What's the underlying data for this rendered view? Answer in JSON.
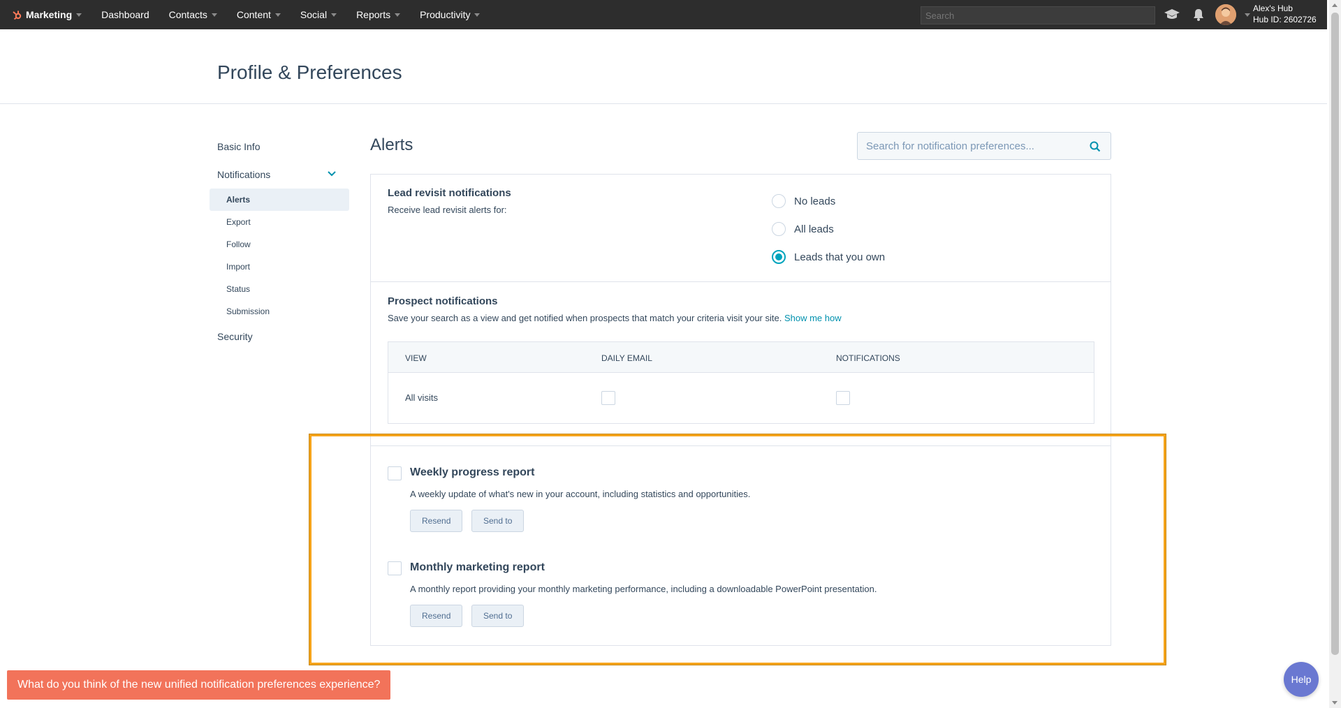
{
  "topnav": {
    "brand": "Marketing",
    "items": [
      {
        "label": "Dashboard",
        "dropdown": false
      },
      {
        "label": "Contacts",
        "dropdown": true
      },
      {
        "label": "Content",
        "dropdown": true
      },
      {
        "label": "Social",
        "dropdown": true
      },
      {
        "label": "Reports",
        "dropdown": true
      },
      {
        "label": "Productivity",
        "dropdown": true
      }
    ],
    "search_placeholder": "Search",
    "hub_name": "Alex's Hub",
    "hub_id": "Hub ID: 2602726"
  },
  "page": {
    "title": "Profile & Preferences"
  },
  "sidebar": {
    "basic_info": "Basic Info",
    "notifications": "Notifications",
    "sub_items": [
      "Alerts",
      "Export",
      "Follow",
      "Import",
      "Status",
      "Submission"
    ],
    "active": "Alerts",
    "security": "Security"
  },
  "main": {
    "title": "Alerts",
    "search_placeholder": "Search for notification preferences..."
  },
  "lead_revisit": {
    "title": "Lead revisit notifications",
    "desc": "Receive lead revisit alerts for:",
    "options": [
      "No leads",
      "All leads",
      "Leads that you own"
    ],
    "selected": "Leads that you own"
  },
  "prospect": {
    "title": "Prospect notifications",
    "desc": "Save your search as a view and get notified when prospects that match your criteria visit your site.",
    "link": "Show me how",
    "columns": [
      "VIEW",
      "DAILY EMAIL",
      "NOTIFICATIONS"
    ],
    "rows": [
      {
        "view": "All visits",
        "daily_email": false,
        "notifications": false
      }
    ]
  },
  "reports": [
    {
      "title": "Weekly progress report",
      "desc": "A weekly update of what's new in your account, including statistics and opportunities.",
      "checked": false,
      "resend": "Resend",
      "send_to": "Send to"
    },
    {
      "title": "Monthly marketing report",
      "desc": "A monthly report providing your monthly marketing performance, including a downloadable PowerPoint presentation.",
      "checked": false,
      "resend": "Resend",
      "send_to": "Send to"
    }
  ],
  "feedback": "What do you think of the new unified notification preferences experience?",
  "help": "Help",
  "colors": {
    "accent": "#00a4bd",
    "highlight": "#f5a31a",
    "feedback": "#f2735a",
    "help": "#6a78d1",
    "nav": "#2d2d2d"
  }
}
